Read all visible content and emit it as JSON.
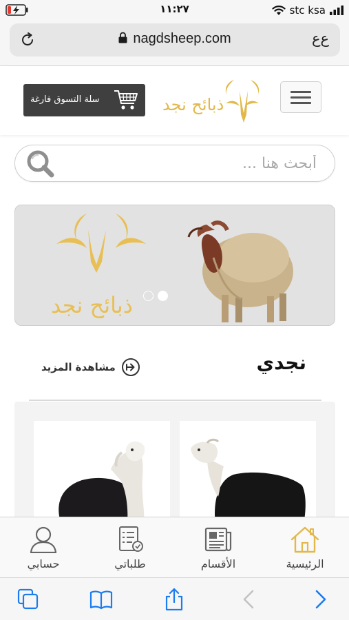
{
  "status_bar": {
    "time": "١١:٢٧",
    "carrier": "stc ksa",
    "icons": [
      "battery-charging-icon",
      "wifi-icon",
      "signal-icon"
    ]
  },
  "address_bar": {
    "url": "nagdsheep.com",
    "text_size_label": "ﻉﻉ",
    "icons": [
      "reload-icon",
      "lock-icon"
    ]
  },
  "header": {
    "cart_label": "سلة التسوق فارغة",
    "logo_text": "ذبائح نجد",
    "icons": [
      "shopping-cart-icon",
      "menu-icon"
    ]
  },
  "search": {
    "placeholder": "أبحث هنا ...",
    "value": ""
  },
  "banner": {
    "logo_text": "ذبائح نجد",
    "slide_count": 2,
    "active_slide": 2
  },
  "section": {
    "title": "نجدي",
    "see_more_label": "مشاهدة المزيد"
  },
  "products": [
    {
      "name": "product-sheep-black-white-neck"
    },
    {
      "name": "product-sheep-black-white-head"
    }
  ],
  "bottom_nav": {
    "items": [
      {
        "label": "حسابي",
        "icon": "user-icon"
      },
      {
        "label": "طلباتي",
        "icon": "orders-icon"
      },
      {
        "label": "الأقسام",
        "icon": "categories-icon"
      },
      {
        "label": "الرئيسية",
        "icon": "home-icon"
      }
    ]
  },
  "safari_toolbar": {
    "icons": [
      "tabs-icon",
      "bookmarks-icon",
      "share-icon",
      "back-icon",
      "forward-icon"
    ]
  },
  "colors": {
    "gold": "#e2b84a",
    "cart_bg": "#3f3f3f",
    "ios_blue": "#1a7cf0",
    "battery_red": "#e8372e"
  }
}
